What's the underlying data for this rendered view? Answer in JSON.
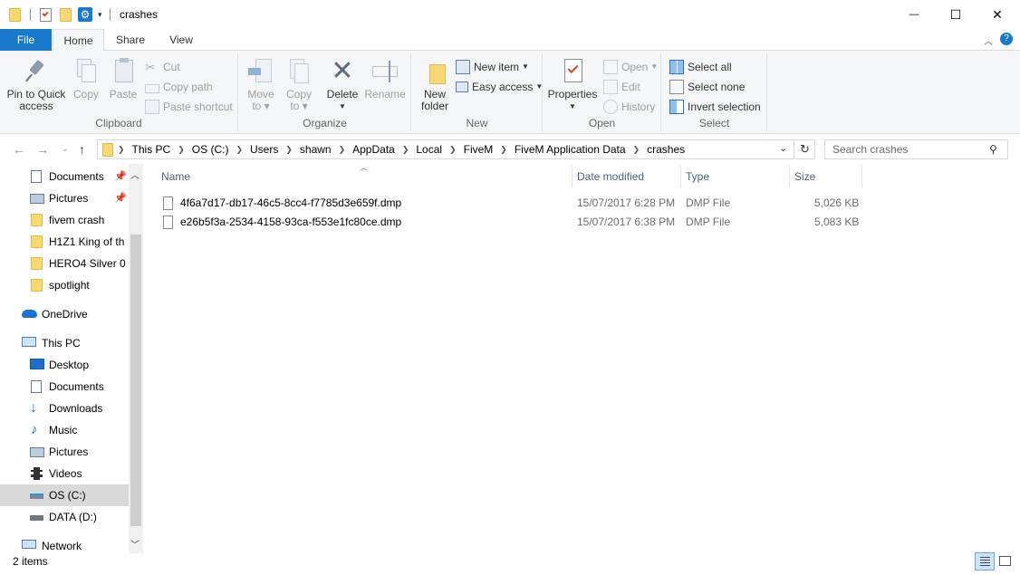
{
  "window": {
    "title": "crashes",
    "minimize_glyph": "—",
    "maximize_glyph": "☐",
    "close_glyph": "✕"
  },
  "tabs": {
    "file": "File",
    "home": "Home",
    "share": "Share",
    "view": "View"
  },
  "ribbon": {
    "clipboard": {
      "label": "Clipboard",
      "pin_quick_access": [
        "Pin to Quick",
        "access"
      ],
      "copy": "Copy",
      "paste": "Paste",
      "cut": "Cut",
      "copy_path": "Copy path",
      "paste_shortcut": "Paste shortcut"
    },
    "organize": {
      "label": "Organize",
      "move_to": "Move",
      "move_to_2": "to",
      "copy_to": "Copy",
      "copy_to_2": "to",
      "delete": "Delete",
      "rename": "Rename"
    },
    "new": {
      "label": "New",
      "new_folder": "New",
      "new_folder_2": "folder",
      "new_item": "New item",
      "easy_access": "Easy access"
    },
    "open": {
      "label": "Open",
      "properties": "Properties",
      "open": "Open",
      "edit": "Edit",
      "history": "History"
    },
    "select": {
      "label": "Select",
      "select_all": "Select all",
      "select_none": "Select none",
      "invert_selection": "Invert selection"
    }
  },
  "address": {
    "crumbs": [
      "This PC",
      "OS (C:)",
      "Users",
      "shawn",
      "AppData",
      "Local",
      "FiveM",
      "FiveM Application Data",
      "crashes"
    ],
    "search_placeholder": "Search crashes"
  },
  "nav_pane": {
    "items": [
      {
        "label": "Documents",
        "icon": "documents-icon",
        "pinned": true
      },
      {
        "label": "Pictures",
        "icon": "pictures-icon",
        "pinned": true
      },
      {
        "label": "fivem crash",
        "icon": "folder-icon"
      },
      {
        "label": "H1Z1  King of th",
        "icon": "folder-icon"
      },
      {
        "label": "HERO4 Silver 0",
        "icon": "folder-icon"
      },
      {
        "label": "spotlight",
        "icon": "folder-icon"
      },
      {
        "label": "OneDrive",
        "icon": "onedrive-icon"
      },
      {
        "label": "This PC",
        "icon": "this-pc-icon"
      },
      {
        "label": "Desktop",
        "icon": "desktop-icon"
      },
      {
        "label": "Documents",
        "icon": "documents-icon"
      },
      {
        "label": "Downloads",
        "icon": "downloads-icon"
      },
      {
        "label": "Music",
        "icon": "music-icon"
      },
      {
        "label": "Pictures",
        "icon": "pictures-icon"
      },
      {
        "label": "Videos",
        "icon": "videos-icon"
      },
      {
        "label": "OS (C:)",
        "icon": "drive-c-icon",
        "selected": true
      },
      {
        "label": "DATA (D:)",
        "icon": "drive-d-icon"
      },
      {
        "label": "Network",
        "icon": "network-icon"
      }
    ]
  },
  "columns": {
    "name": "Name",
    "date_modified": "Date modified",
    "type": "Type",
    "size": "Size"
  },
  "files": [
    {
      "name": "4f6a7d17-db17-46c5-8cc4-f7785d3e659f.dmp",
      "date": "15/07/2017 6:28 PM",
      "type": "DMP File",
      "size": "5,026 KB"
    },
    {
      "name": "e26b5f3a-2534-4158-93ca-f553e1fc80ce.dmp",
      "date": "15/07/2017 6:38 PM",
      "type": "DMP File",
      "size": "5,083 KB"
    }
  ],
  "status": {
    "item_count": "2 items"
  },
  "colors": {
    "accent": "#1979ca",
    "folder": "#f8d775",
    "ribbon_bg": "#f5f6f7",
    "selected": "#d9d9d9"
  }
}
